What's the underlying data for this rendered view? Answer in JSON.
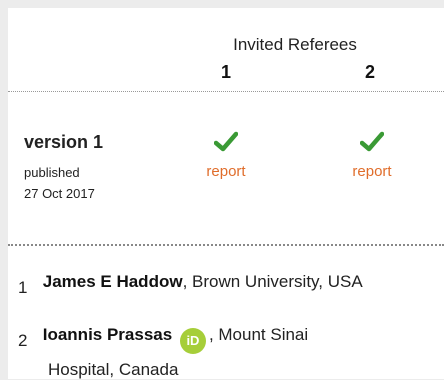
{
  "header": {
    "invited_referees": "Invited Referees",
    "referee_numbers": [
      "1",
      "2"
    ]
  },
  "version": {
    "label": "version 1",
    "published_label": "published",
    "published_date": "27 Oct 2017",
    "reports": [
      {
        "status_icon": "approved-check-icon",
        "link": "report",
        "color": "#e06d2b"
      },
      {
        "status_icon": "approved-check-icon",
        "link": "report",
        "color": "#e06d2b"
      }
    ],
    "check_color": "#3a9a35"
  },
  "referees": [
    {
      "index": "1",
      "name": "James E Haddow",
      "affiliation": ", Brown University, USA"
    },
    {
      "index": "2",
      "name": "Ioannis Prassas",
      "orcid_icon": "orcid-icon",
      "orcid_text": "iD",
      "affiliation": ", Mount Sinai",
      "affiliation_cont": "Hospital, Canada"
    }
  ]
}
